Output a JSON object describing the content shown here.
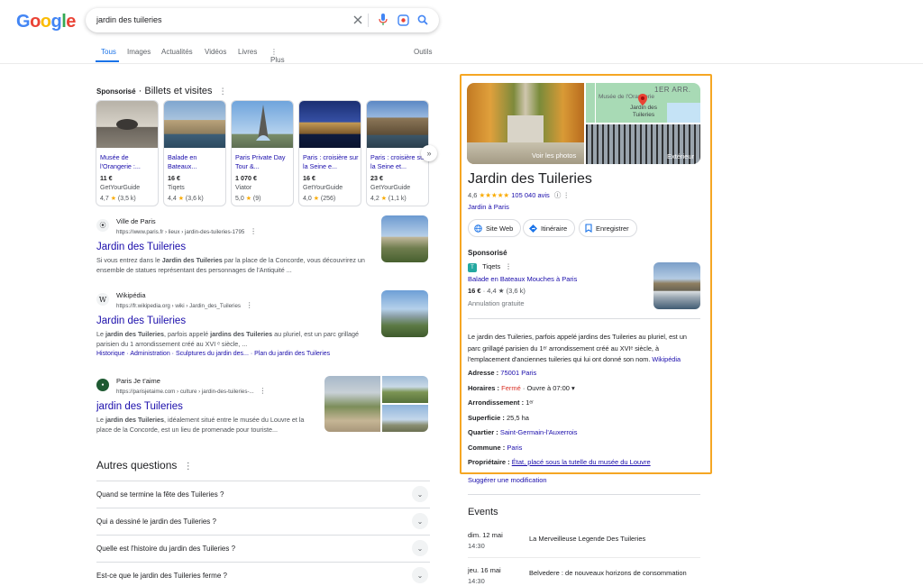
{
  "header": {
    "logo": "Google",
    "logo_colors": [
      "#4285f4",
      "#ea4335",
      "#fbbc05",
      "#4285f4",
      "#34a853",
      "#ea4335"
    ],
    "query": "jardin des tuileries",
    "tabs": [
      "Tous",
      "Images",
      "Actualités",
      "Vidéos",
      "Livres",
      "⋮ Plus"
    ],
    "tools": "Outils"
  },
  "sponsored": {
    "label": "Sponsorisé",
    "heading": " · Billets et visites",
    "cards": [
      {
        "title": "Musée de l'Orangerie :...",
        "price": "11 €",
        "vendor": "GetYourGuide",
        "rating": "4,7",
        "reviews": "(3,5 k)"
      },
      {
        "title": "Balade en Bateaux...",
        "price": "16 €",
        "vendor": "Tiqets",
        "rating": "4,4",
        "reviews": "(3,6 k)"
      },
      {
        "title": "Paris Private Day Tour &...",
        "price": "1 070 €",
        "vendor": "Viator",
        "rating": "5,0",
        "reviews": "(9)"
      },
      {
        "title": "Paris : croisière sur la Seine e...",
        "price": "16 €",
        "vendor": "GetYourGuide",
        "rating": "4,0",
        "reviews": "(256)"
      },
      {
        "title": "Paris : croisière sur la Seine et...",
        "price": "23 €",
        "vendor": "GetYourGuide",
        "rating": "4,2",
        "reviews": "(1,1 k)"
      }
    ]
  },
  "results": [
    {
      "site": "Ville de Paris",
      "url": "https://www.paris.fr › lieux › jardin-des-tuileries-1795",
      "title": "Jardin des Tuileries",
      "snippet_html": "Si vous entrez dans le <b>Jardin des Tuileries</b> par la place de la Concorde, vous découvrirez un ensemble de statues représentant des personnages de l'Antiquité ..."
    },
    {
      "site": "Wikipédia",
      "url": "https://fr.wikipedia.org › wiki › Jardin_des_Tuileries",
      "title": "Jardin des Tuileries",
      "snippet_html": "Le <b>jardin des Tuileries</b>, parfois appelé <b>jardins des Tuileries</b> au pluriel, est un parc grillagé parisien du 1 arrondissement créé au XVI ᵉ siècle, ...",
      "sitelinks": [
        "Historique",
        "Administration",
        "Sculptures du jardin des...",
        "Plan du jardin des Tuileries"
      ]
    },
    {
      "site": "Paris Je t'aime",
      "url": "https://parisjetaime.com › culture › jardin-des-tuileries-...",
      "title": "jardin des Tuileries",
      "snippet_html": "Le <b>jardin des Tuileries</b>, idéalement situé entre le musée du Louvre et la place de la Concorde, est un lieu de promenade pour touriste..."
    }
  ],
  "paa": {
    "title": "Autres questions",
    "questions": [
      "Quand se termine la fête des Tuileries ?",
      "Qui a dessiné le jardin des Tuileries ?",
      "Quelle est l'histoire du jardin des Tuileries ?",
      "Est-ce que le jardin des Tuileries ferme ?"
    ]
  },
  "kp": {
    "photo_label": "Voir les photos",
    "map_label1": "Musée de l'Orangerie",
    "map_label2": "Jardin des Tuileries",
    "map_arr": "1ER ARR.",
    "exterior_label": "Extérieur",
    "title": "Jardin des Tuileries",
    "rating": "4,6",
    "reviews": "105 040 avis",
    "type": "Jardin à Paris",
    "buttons": [
      "Site Web",
      "Itinéraire",
      "Enregistrer"
    ],
    "sponsored": "Sponsorisé",
    "ad_vendor": "Tiqets",
    "ad_title": "Balade en Bateaux Mouches à Paris",
    "ad_price": "16 €",
    "ad_rating": "· 4,4 ★ (3,6 k)",
    "ad_note": "Annulation gratuite",
    "description": "Le jardin des Tuileries, parfois appelé jardins des Tuileries au pluriel, est un parc grillagé parisien du 1ᵉʳ arrondissement créé au XVIᵉ siècle, à l'emplacement d'anciennes tuileries qui lui ont donné son nom.",
    "desc_link": "Wikipédia",
    "facts": {
      "adresse_label": "Adresse : ",
      "adresse": "75001 Paris",
      "horaires_label": "Horaires : ",
      "horaires_status": "Fermé",
      "horaires_rest": " · Ouvre à 07:00 ▾",
      "arr_label": "Arrondissement : ",
      "arr": "1ᵉʳ",
      "sup_label": "Superficie : ",
      "sup": "25,5 ha",
      "quartier_label": "Quartier : ",
      "quartier": "Saint-Germain-l'Auxerrois",
      "commune_label": "Commune : ",
      "commune": "Paris",
      "prop_label": "Propriétaire : ",
      "prop": "État, placé sous la tutelle du musée du Louvre"
    },
    "suggest": "Suggérer une modification",
    "events_title": "Events",
    "events": [
      {
        "date": "dim. 12 mai",
        "time": "14:30",
        "name": "La Merveilleuse Legende Des Tuileries"
      },
      {
        "date": "jeu. 16 mai",
        "time": "14:30",
        "name": "Belvedere : de nouveaux horizons de consommation"
      }
    ]
  }
}
